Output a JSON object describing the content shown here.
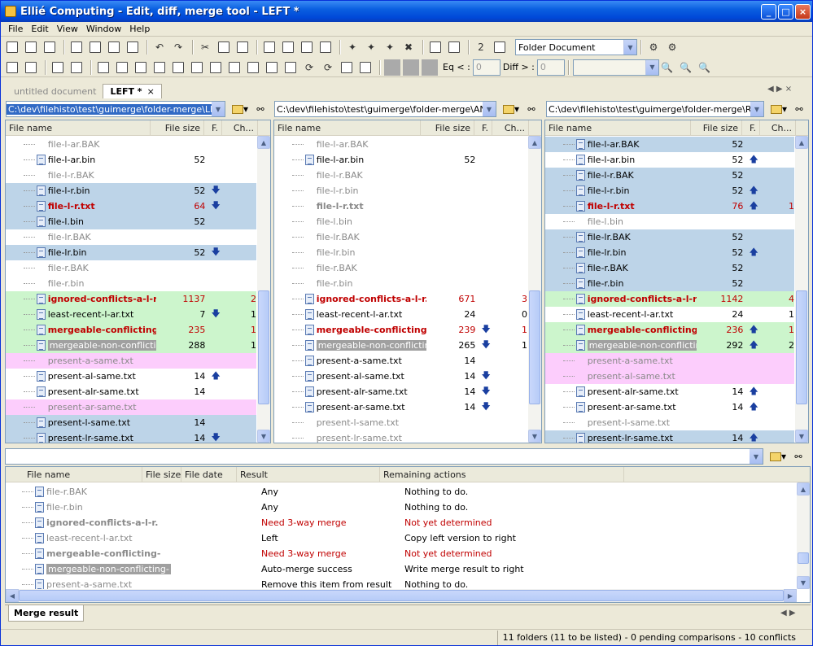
{
  "window": {
    "title": "Ellié Computing - Edit, diff, merge tool - LEFT *",
    "buttons": {
      "minimize": "_",
      "maximize": "□",
      "close": "×"
    }
  },
  "menu": [
    "File",
    "Edit",
    "View",
    "Window",
    "Help"
  ],
  "toolbar": {
    "document_type": "Folder Document",
    "eq_label": "Eq < :",
    "eq_value": "0",
    "diff_label": "Diff > :",
    "diff_value": "0"
  },
  "tabs": [
    {
      "label": "untitled document",
      "active": false
    },
    {
      "label": "LEFT *",
      "active": true,
      "close": "×"
    }
  ],
  "paths": {
    "left": "C:\\dev\\filehisto\\test\\guimerge\\folder-merge\\LEFT",
    "ancestor": "C:\\dev\\filehisto\\test\\guimerge\\folder-merge\\ANCES",
    "right": "C:\\dev\\filehisto\\test\\guimerge\\folder-merge\\RIGHT"
  },
  "columns": {
    "name": "File name",
    "size": "File size",
    "flag": "F.",
    "changes": "Ch..."
  },
  "left_rows": [
    {
      "name": "file-l-ar.BAK",
      "style": "gray",
      "icon": false,
      "size": "",
      "arrow": "",
      "ch": "",
      "bg": ""
    },
    {
      "name": "file-l-ar.bin",
      "style": "",
      "icon": true,
      "size": "52",
      "arrow": "",
      "ch": "",
      "bg": ""
    },
    {
      "name": "file-l-r.BAK",
      "style": "gray",
      "icon": false,
      "size": "",
      "arrow": "",
      "ch": "",
      "bg": ""
    },
    {
      "name": "file-l-r.bin",
      "style": "",
      "icon": true,
      "size": "52",
      "arrow": "down",
      "ch": "",
      "bg": "blue"
    },
    {
      "name": "file-l-r.txt",
      "style": "red",
      "icon": true,
      "size": "64",
      "sizered": true,
      "arrow": "down",
      "ch": "",
      "bg": "blue"
    },
    {
      "name": "file-l.bin",
      "style": "",
      "icon": true,
      "size": "52",
      "arrow": "",
      "ch": "",
      "bg": "blue"
    },
    {
      "name": "file-lr.BAK",
      "style": "gray",
      "icon": false,
      "size": "",
      "arrow": "",
      "ch": "",
      "bg": ""
    },
    {
      "name": "file-lr.bin",
      "style": "",
      "icon": true,
      "size": "52",
      "arrow": "down",
      "ch": "",
      "bg": "blue"
    },
    {
      "name": "file-r.BAK",
      "style": "gray",
      "icon": false,
      "size": "",
      "arrow": "",
      "ch": "",
      "bg": ""
    },
    {
      "name": "file-r.bin",
      "style": "gray",
      "icon": false,
      "size": "",
      "arrow": "",
      "ch": "",
      "bg": ""
    },
    {
      "name": "ignored-conflicts-a-l-r.",
      "style": "red",
      "icon": true,
      "size": "1137",
      "sizered": true,
      "arrow": "",
      "ch": "2",
      "chred": true,
      "bg": "green"
    },
    {
      "name": "least-recent-l-ar.txt",
      "style": "",
      "icon": true,
      "size": "7",
      "arrow": "down",
      "ch": "1",
      "bg": "green"
    },
    {
      "name": "mergeable-conflicting-",
      "style": "red",
      "icon": true,
      "size": "235",
      "sizered": true,
      "arrow": "",
      "ch": "1",
      "chred": true,
      "bg": "green"
    },
    {
      "name": "mergeable-non-conflicting-",
      "style": "hl",
      "icon": true,
      "size": "288",
      "arrow": "",
      "ch": "1",
      "bg": "green"
    },
    {
      "name": "present-a-same.txt",
      "style": "gray",
      "icon": false,
      "size": "",
      "arrow": "",
      "ch": "",
      "bg": "pink"
    },
    {
      "name": "present-al-same.txt",
      "style": "",
      "icon": true,
      "size": "14",
      "arrow": "up",
      "ch": "",
      "bg": ""
    },
    {
      "name": "present-alr-same.txt",
      "style": "",
      "icon": true,
      "size": "14",
      "arrow": "",
      "ch": "",
      "bg": ""
    },
    {
      "name": "present-ar-same.txt",
      "style": "gray",
      "icon": false,
      "size": "",
      "arrow": "",
      "ch": "",
      "bg": "pink"
    },
    {
      "name": "present-l-same.txt",
      "style": "",
      "icon": true,
      "size": "14",
      "arrow": "",
      "ch": "",
      "bg": "blue"
    },
    {
      "name": "present-lr-same.txt",
      "style": "",
      "icon": true,
      "size": "14",
      "arrow": "down",
      "ch": "",
      "bg": "blue"
    }
  ],
  "mid_rows": [
    {
      "name": "file-l-ar.BAK",
      "style": "gray",
      "icon": false,
      "size": "",
      "arrow": "",
      "ch": "",
      "bg": ""
    },
    {
      "name": "file-l-ar.bin",
      "style": "",
      "icon": true,
      "size": "52",
      "arrow": "",
      "ch": "",
      "bg": ""
    },
    {
      "name": "file-l-r.BAK",
      "style": "gray",
      "icon": false,
      "size": "",
      "arrow": "",
      "ch": "",
      "bg": ""
    },
    {
      "name": "file-l-r.bin",
      "style": "gray",
      "icon": false,
      "size": "",
      "arrow": "",
      "ch": "",
      "bg": ""
    },
    {
      "name": "file-l-r.txt",
      "style": "graybold",
      "icon": false,
      "size": "",
      "arrow": "",
      "ch": "",
      "bg": ""
    },
    {
      "name": "file-l.bin",
      "style": "gray",
      "icon": false,
      "size": "",
      "arrow": "",
      "ch": "",
      "bg": ""
    },
    {
      "name": "file-lr.BAK",
      "style": "gray",
      "icon": false,
      "size": "",
      "arrow": "",
      "ch": "",
      "bg": ""
    },
    {
      "name": "file-lr.bin",
      "style": "gray",
      "icon": false,
      "size": "",
      "arrow": "",
      "ch": "",
      "bg": ""
    },
    {
      "name": "file-r.BAK",
      "style": "gray",
      "icon": false,
      "size": "",
      "arrow": "",
      "ch": "",
      "bg": ""
    },
    {
      "name": "file-r.bin",
      "style": "gray",
      "icon": false,
      "size": "",
      "arrow": "",
      "ch": "",
      "bg": ""
    },
    {
      "name": "ignored-conflicts-a-l-r.",
      "style": "red",
      "icon": true,
      "size": "671",
      "sizered": true,
      "arrow": "",
      "ch": "3",
      "chred": true,
      "bg": ""
    },
    {
      "name": "least-recent-l-ar.txt",
      "style": "",
      "icon": true,
      "size": "24",
      "arrow": "",
      "ch": "0",
      "bg": ""
    },
    {
      "name": "mergeable-conflicting-",
      "style": "red",
      "icon": true,
      "size": "239",
      "sizered": true,
      "arrow": "down",
      "ch": "1",
      "chred": true,
      "bg": ""
    },
    {
      "name": "mergeable-non-conflicting-",
      "style": "hl",
      "icon": true,
      "size": "265",
      "arrow": "down",
      "ch": "1",
      "bg": ""
    },
    {
      "name": "present-a-same.txt",
      "style": "",
      "icon": true,
      "size": "14",
      "arrow": "",
      "ch": "",
      "bg": ""
    },
    {
      "name": "present-al-same.txt",
      "style": "",
      "icon": true,
      "size": "14",
      "arrow": "down",
      "ch": "",
      "bg": ""
    },
    {
      "name": "present-alr-same.txt",
      "style": "",
      "icon": true,
      "size": "14",
      "arrow": "down",
      "ch": "",
      "bg": ""
    },
    {
      "name": "present-ar-same.txt",
      "style": "",
      "icon": true,
      "size": "14",
      "arrow": "down",
      "ch": "",
      "bg": ""
    },
    {
      "name": "present-l-same.txt",
      "style": "gray",
      "icon": false,
      "size": "",
      "arrow": "",
      "ch": "",
      "bg": ""
    },
    {
      "name": "present-lr-same.txt",
      "style": "gray",
      "icon": false,
      "size": "",
      "arrow": "",
      "ch": "",
      "bg": ""
    }
  ],
  "right_rows": [
    {
      "name": "file-l-ar.BAK",
      "style": "",
      "icon": true,
      "size": "52",
      "arrow": "",
      "ch": "",
      "bg": "blue"
    },
    {
      "name": "file-l-ar.bin",
      "style": "",
      "icon": true,
      "size": "52",
      "arrow": "up",
      "ch": "",
      "bg": ""
    },
    {
      "name": "file-l-r.BAK",
      "style": "",
      "icon": true,
      "size": "52",
      "arrow": "",
      "ch": "",
      "bg": "blue"
    },
    {
      "name": "file-l-r.bin",
      "style": "",
      "icon": true,
      "size": "52",
      "arrow": "up",
      "ch": "",
      "bg": "blue"
    },
    {
      "name": "file-l-r.txt",
      "style": "red",
      "icon": true,
      "size": "76",
      "sizered": true,
      "arrow": "up",
      "ch": "1",
      "chred": true,
      "bg": "blue"
    },
    {
      "name": "file-l.bin",
      "style": "gray",
      "icon": false,
      "size": "",
      "arrow": "",
      "ch": "",
      "bg": ""
    },
    {
      "name": "file-lr.BAK",
      "style": "",
      "icon": true,
      "size": "52",
      "arrow": "",
      "ch": "",
      "bg": "blue"
    },
    {
      "name": "file-lr.bin",
      "style": "",
      "icon": true,
      "size": "52",
      "arrow": "up",
      "ch": "",
      "bg": "blue"
    },
    {
      "name": "file-r.BAK",
      "style": "",
      "icon": true,
      "size": "52",
      "arrow": "",
      "ch": "",
      "bg": "blue"
    },
    {
      "name": "file-r.bin",
      "style": "",
      "icon": true,
      "size": "52",
      "arrow": "",
      "ch": "",
      "bg": "blue"
    },
    {
      "name": "ignored-conflicts-a-l-r.",
      "style": "red",
      "icon": true,
      "size": "1142",
      "sizered": true,
      "arrow": "",
      "ch": "4",
      "chred": true,
      "bg": "green"
    },
    {
      "name": "least-recent-l-ar.txt",
      "style": "",
      "icon": true,
      "size": "24",
      "arrow": "",
      "ch": "1",
      "bg": ""
    },
    {
      "name": "mergeable-conflicting-",
      "style": "red",
      "icon": true,
      "size": "236",
      "sizered": true,
      "arrow": "up",
      "ch": "1",
      "chred": true,
      "bg": "green"
    },
    {
      "name": "mergeable-non-conflicting-",
      "style": "hl",
      "icon": true,
      "size": "292",
      "arrow": "up",
      "ch": "2",
      "bg": "green"
    },
    {
      "name": "present-a-same.txt",
      "style": "gray",
      "icon": false,
      "size": "",
      "arrow": "",
      "ch": "",
      "bg": "pink"
    },
    {
      "name": "present-al-same.txt",
      "style": "gray",
      "icon": false,
      "size": "",
      "arrow": "",
      "ch": "",
      "bg": "pink"
    },
    {
      "name": "present-alr-same.txt",
      "style": "",
      "icon": true,
      "size": "14",
      "arrow": "up",
      "ch": "",
      "bg": ""
    },
    {
      "name": "present-ar-same.txt",
      "style": "",
      "icon": true,
      "size": "14",
      "arrow": "up",
      "ch": "",
      "bg": ""
    },
    {
      "name": "present-l-same.txt",
      "style": "gray",
      "icon": false,
      "size": "",
      "arrow": "",
      "ch": "",
      "bg": ""
    },
    {
      "name": "present-lr-same.txt",
      "style": "",
      "icon": true,
      "size": "14",
      "arrow": "up",
      "ch": "",
      "bg": "blue"
    }
  ],
  "result_columns": {
    "name": "File name",
    "size": "File size",
    "date": "File date",
    "result": "Result",
    "actions": "Remaining actions"
  },
  "result_rows": [
    {
      "name": "file-r.BAK",
      "style": "gray",
      "result": "Any",
      "resred": false,
      "action": "Nothing to do.",
      "actred": false
    },
    {
      "name": "file-r.bin",
      "style": "gray",
      "result": "Any",
      "resred": false,
      "action": "Nothing to do.",
      "actred": false
    },
    {
      "name": "ignored-conflicts-a-l-r.",
      "style": "graybold",
      "result": "Need 3-way merge",
      "resred": true,
      "action": "Not yet determined",
      "actred": true
    },
    {
      "name": "least-recent-l-ar.txt",
      "style": "gray",
      "result": "Left",
      "resred": false,
      "action": "Copy left version to right",
      "actred": false
    },
    {
      "name": "mergeable-conflicting-",
      "style": "graybold",
      "result": "Need 3-way merge",
      "resred": true,
      "action": "Not yet determined",
      "actred": true
    },
    {
      "name": "mergeable-non-conflicting-",
      "style": "hl",
      "result": "Auto-merge success",
      "resred": false,
      "action": "Write merge result to right",
      "actred": false
    },
    {
      "name": "present-a-same.txt",
      "style": "gray",
      "result": "Remove this item from result",
      "resred": false,
      "action": "Nothing to do.",
      "actred": false
    }
  ],
  "bottom_tab": "Merge result",
  "status": "11 folders (11 to be listed) - 0 pending comparisons - 10 conflicts"
}
